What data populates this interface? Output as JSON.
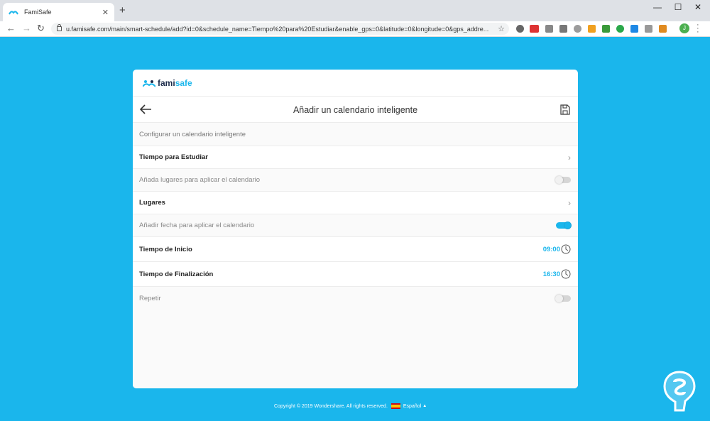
{
  "browser": {
    "tab_title": "FamiSafe",
    "new_tab": "+",
    "url": "u.famisafe.com/main/smart-schedule/add?id=0&schedule_name=Tiempo%20para%20Estudiar&enable_gps=0&latitude=0&longitude=0&gps_addre...",
    "profile_initial": "J"
  },
  "logo": {
    "part1": "fami",
    "part2": "safe"
  },
  "header": {
    "title": "Añadir un calendario inteligente"
  },
  "section": {
    "label": "Configurar un calendario inteligente"
  },
  "rows": {
    "schedule_name": "Tiempo para Estudiar",
    "add_places": "Añada lugares para aplicar el calendario",
    "places": "Lugares",
    "add_date": "Añadir fecha para aplicar el calendario",
    "start_time_label": "Tiempo de Inicio",
    "start_time_value": "09:00",
    "end_time_label": "Tiempo de Finalización",
    "end_time_value": "16:30",
    "repeat": "Repetir"
  },
  "toggles": {
    "add_places": false,
    "add_date": true,
    "repeat": false
  },
  "footer": {
    "copyright": "Copyright © 2019 Wondershare. All rights reserved.",
    "language": "Español"
  },
  "colors": {
    "accent": "#1ab6ec",
    "page_bg": "#1ab6ec",
    "brand_dark": "#1c2b4a"
  },
  "icons": [
    "back-arrow-icon",
    "save-icon",
    "chevron-right-icon",
    "clock-icon",
    "lock-icon",
    "star-icon"
  ]
}
